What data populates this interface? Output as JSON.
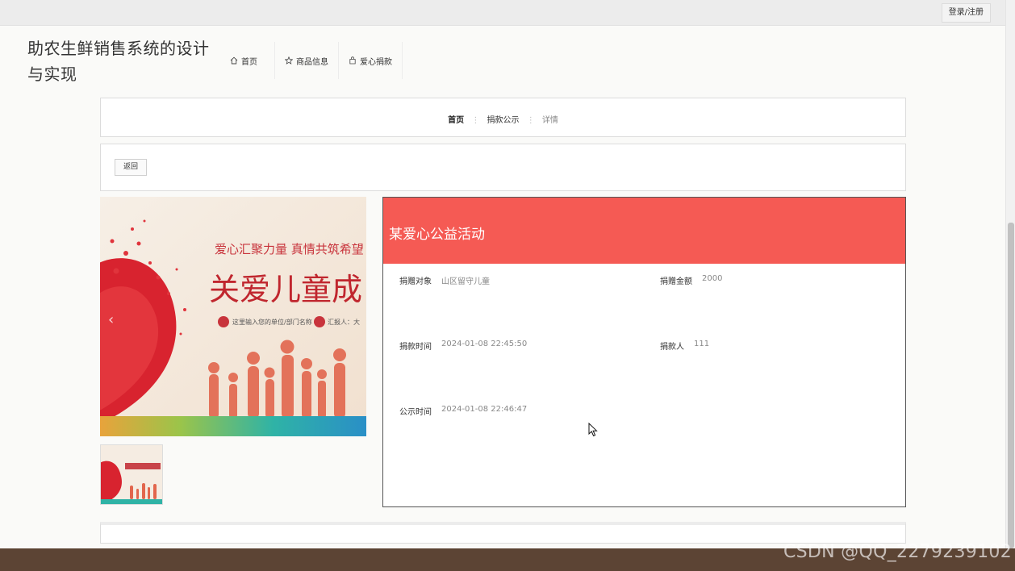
{
  "topbar": {
    "login_label": "登录/注册"
  },
  "header": {
    "title": "助农生鲜销售系统的设计与实现"
  },
  "nav": {
    "items": [
      {
        "label": "首页",
        "icon": "home-icon"
      },
      {
        "label": "商品信息",
        "icon": "star-icon"
      },
      {
        "label": "爱心捐款",
        "icon": "bag-icon"
      }
    ]
  },
  "breadcrumb": {
    "home": "首页",
    "section": "捐款公示",
    "current": "详情"
  },
  "actions": {
    "back_label": "返回"
  },
  "banner": {
    "slogan": "爱心汇聚力量  真情共筑希望",
    "headline": "关爱儿童成",
    "footnote_unit": "这里输入您的单位/部门名称",
    "footnote_reporter": "汇报人：大"
  },
  "detail": {
    "title": "某爱心公益活动",
    "fields": [
      {
        "label": "捐赠对象",
        "value": "山区留守儿童"
      },
      {
        "label": "捐赠金额",
        "value": "2000"
      },
      {
        "label": "捐款时间",
        "value": "2024-01-08 22:45:50"
      },
      {
        "label": "捐款人",
        "value": "111"
      },
      {
        "label": "公示时间",
        "value": "2024-01-08 22:46:47"
      }
    ]
  },
  "colors": {
    "accent": "#f55a54",
    "footer": "#5c4434"
  },
  "watermark": "CSDN @QQ_2279239102"
}
